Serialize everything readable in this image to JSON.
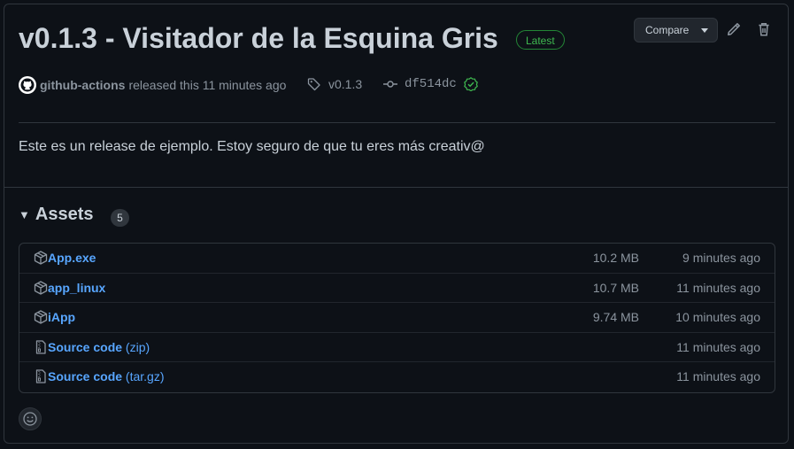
{
  "release": {
    "title": "v0.1.3 - Visitador de la Esquina Gris",
    "badge": "Latest",
    "compare_label": "Compare",
    "author": "github-actions",
    "released_text": "released this 11 minutes ago",
    "tag": "v0.1.3",
    "commit": "df514dc",
    "body": "Este es un release de ejemplo. Estoy seguro de que tu eres más creativ@"
  },
  "assets": {
    "heading": "Assets",
    "count": "5",
    "items": [
      {
        "name": "App.exe",
        "suffix": "",
        "size": "10.2 MB",
        "time": "9 minutes ago",
        "icon": "package-icon"
      },
      {
        "name": "app_linux",
        "suffix": "",
        "size": "10.7 MB",
        "time": "11 minutes ago",
        "icon": "package-icon"
      },
      {
        "name": "iApp",
        "suffix": "",
        "size": "9.74 MB",
        "time": "10 minutes ago",
        "icon": "package-icon"
      },
      {
        "name": "Source code",
        "suffix": " (zip)",
        "size": "",
        "time": "11 minutes ago",
        "icon": "file-zip-icon"
      },
      {
        "name": "Source code",
        "suffix": " (tar.gz)",
        "size": "",
        "time": "11 minutes ago",
        "icon": "file-zip-icon"
      }
    ]
  },
  "colors": {
    "background": "#0d1117",
    "border": "#30363d",
    "link": "#58a6ff",
    "success": "#3fb950",
    "text": "#c9d1d9",
    "muted": "#8b949e"
  }
}
